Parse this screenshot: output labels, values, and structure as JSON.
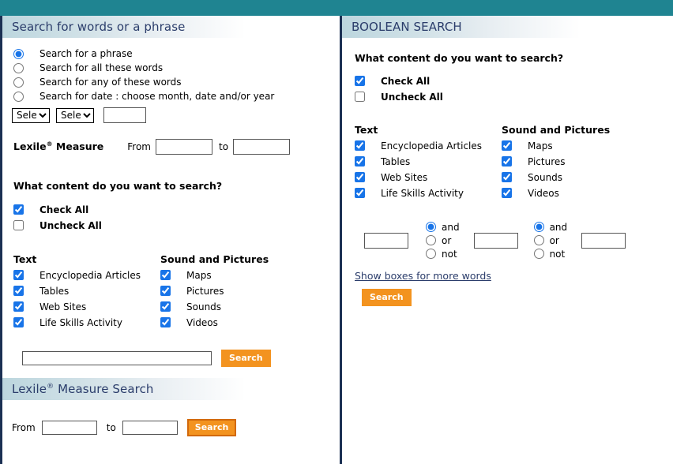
{
  "topbar": {
    "color": "#1f8491"
  },
  "theme": {
    "accent_orange": "#f3931f",
    "heading_navy": "#2b3d6b",
    "divider_navy": "#1b3053",
    "checkbox_blue": "#1874e8"
  },
  "left_panel": {
    "header": {
      "title": "Search for words or a phrase"
    },
    "search_modes": {
      "group_name": "searchmode",
      "options": [
        {
          "label": "Search for a phrase",
          "checked": true
        },
        {
          "label": "Search for all these words",
          "checked": false
        },
        {
          "label": "Search for any of these words",
          "checked": false
        },
        {
          "label": "Search for date : choose month, date and/or year",
          "checked": false
        }
      ]
    },
    "date_row": {
      "month_select": {
        "selected": "Select",
        "options": [
          "Select"
        ]
      },
      "day_select": {
        "selected": "Select",
        "options": [
          "Select"
        ]
      },
      "year_input": {
        "value": "",
        "placeholder": ""
      }
    },
    "lexile": {
      "label": "Lexile",
      "sup": "®",
      "label_tail": " Measure",
      "from_label": "From",
      "to_label": "to",
      "from_value": "",
      "to_value": ""
    },
    "content_question": "What content do you want to search?",
    "check_all": {
      "label": "Check All",
      "checked": true
    },
    "uncheck_all": {
      "label": "Uncheck All",
      "checked": false
    },
    "text_column": {
      "heading": "Text",
      "items": [
        {
          "label": "Encyclopedia Articles",
          "checked": true
        },
        {
          "label": "Tables",
          "checked": true
        },
        {
          "label": "Web Sites",
          "checked": true
        },
        {
          "label": "Life Skills Activity",
          "checked": true
        }
      ]
    },
    "media_column": {
      "heading": "Sound and Pictures",
      "items": [
        {
          "label": "Maps",
          "checked": true
        },
        {
          "label": "Pictures",
          "checked": true
        },
        {
          "label": "Sounds",
          "checked": true
        },
        {
          "label": "Videos",
          "checked": true
        }
      ]
    },
    "keyword_input": {
      "value": "",
      "placeholder": ""
    },
    "search_button": {
      "label": "Search"
    },
    "lexile_search": {
      "header_label": "Lexile",
      "header_sup": "®",
      "header_tail": " Measure Search",
      "from_label": "From",
      "to_label": "to",
      "from_value": "",
      "to_value": "",
      "button_label": "Search"
    }
  },
  "right_panel": {
    "header": {
      "title": "BOOLEAN SEARCH"
    },
    "content_question": "What content do you want to search?",
    "check_all": {
      "label": "Check All",
      "checked": true
    },
    "uncheck_all": {
      "label": "Uncheck All",
      "checked": false
    },
    "text_column": {
      "heading": "Text",
      "items": [
        {
          "label": "Encyclopedia Articles",
          "checked": true
        },
        {
          "label": "Tables",
          "checked": true
        },
        {
          "label": "Web Sites",
          "checked": true
        },
        {
          "label": "Life Skills Activity",
          "checked": true
        }
      ]
    },
    "media_column": {
      "heading": "Sound and Pictures",
      "items": [
        {
          "label": "Maps",
          "checked": true
        },
        {
          "label": "Pictures",
          "checked": true
        },
        {
          "label": "Sounds",
          "checked": true
        },
        {
          "label": "Videos",
          "checked": true
        }
      ]
    },
    "term1": {
      "value": "",
      "placeholder": ""
    },
    "term2": {
      "value": "",
      "placeholder": ""
    },
    "term3": {
      "value": "",
      "placeholder": ""
    },
    "operator_group_1": {
      "group_name": "bool-op-1",
      "options": [
        {
          "label": "and",
          "checked": true
        },
        {
          "label": "or",
          "checked": false
        },
        {
          "label": "not",
          "checked": false
        }
      ]
    },
    "operator_group_2": {
      "group_name": "bool-op-2",
      "options": [
        {
          "label": "and",
          "checked": true
        },
        {
          "label": "or",
          "checked": false
        },
        {
          "label": "not",
          "checked": false
        }
      ]
    },
    "more_words_link": "Show boxes for more words",
    "search_button": {
      "label": "Search"
    }
  }
}
